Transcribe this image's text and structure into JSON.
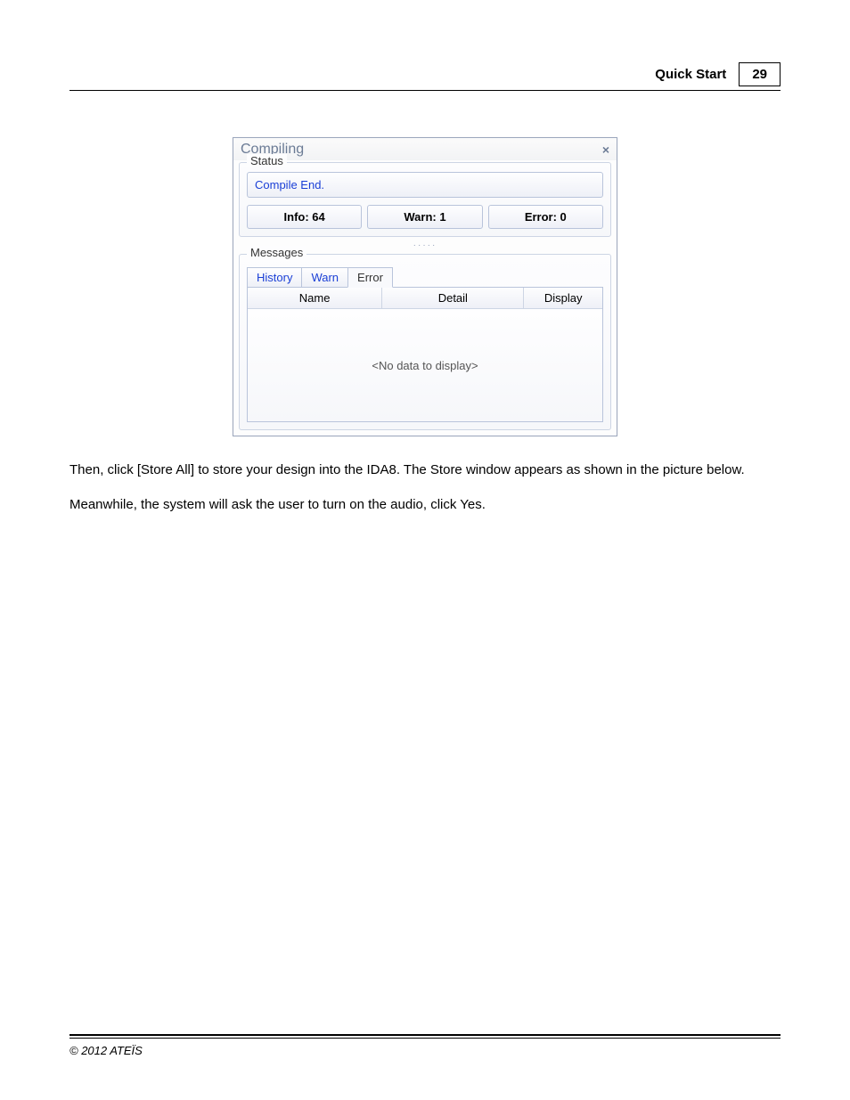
{
  "header": {
    "section": "Quick Start",
    "page_number": "29"
  },
  "dialog": {
    "title": "Compiling",
    "close_glyph": "×",
    "status_group_label": "Status",
    "status_message": "Compile End.",
    "info_label": "Info: 64",
    "warn_label": "Warn: 1",
    "error_label": "Error: 0",
    "messages_group_label": "Messages",
    "tabs": {
      "history": "History",
      "warn": "Warn",
      "error": "Error"
    },
    "columns": {
      "name": "Name",
      "detail": "Detail",
      "display": "Display"
    },
    "empty_text": "<No data to display>"
  },
  "paragraphs": {
    "p1": "Then, click [Store All] to store your design into the IDA8. The Store window appears as shown in the picture below.",
    "p2": "Meanwhile, the system will ask the user to turn on the audio, click Yes."
  },
  "footer": {
    "copyright": "© 2012 ATEÏS"
  }
}
